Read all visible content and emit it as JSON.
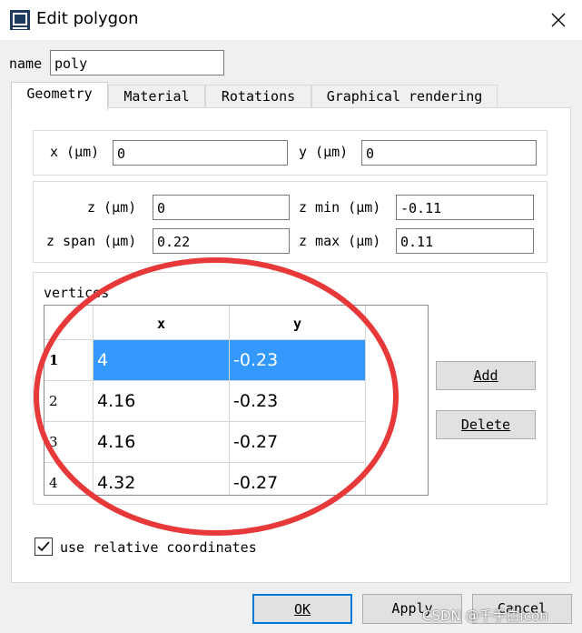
{
  "window": {
    "title": "Edit polygon",
    "icon": "app-window-icon",
    "close_icon": "close-icon"
  },
  "name_row": {
    "label": "name",
    "value": "poly"
  },
  "tabs": [
    {
      "label": "Geometry",
      "active": true
    },
    {
      "label": "Material",
      "active": false
    },
    {
      "label": "Rotations",
      "active": false
    },
    {
      "label": "Graphical rendering",
      "active": false
    }
  ],
  "geometry": {
    "x": {
      "label": "x (μm)",
      "value": "0"
    },
    "y": {
      "label": "y (μm)",
      "value": "0"
    },
    "z": {
      "label": "z (μm)",
      "value": "0"
    },
    "z_min": {
      "label": "z min (μm)",
      "value": "-0.11"
    },
    "z_span": {
      "label": "z span (μm)",
      "value": "0.22"
    },
    "z_max": {
      "label": "z max (μm)",
      "value": "0.11"
    }
  },
  "vertices": {
    "label": "vertices",
    "columns": [
      "x",
      "y"
    ],
    "rows": [
      {
        "index": "1",
        "x": "4",
        "y": "-0.23",
        "selected": true
      },
      {
        "index": "2",
        "x": "4.16",
        "y": "-0.23",
        "selected": false
      },
      {
        "index": "3",
        "x": "4.16",
        "y": "-0.27",
        "selected": false
      },
      {
        "index": "4",
        "x": "4.32",
        "y": "-0.27",
        "selected": false
      }
    ],
    "add_button": "Add",
    "delete_button": "Delete"
  },
  "relative_coords": {
    "label": "use relative coordinates",
    "checked": true
  },
  "footer": {
    "ok": "OK",
    "apply": "Apply",
    "cancel": "Cancel"
  },
  "watermark": "CSDN @千手白icon",
  "colors": {
    "selection": "#3399ff",
    "annotation": "#e8393a",
    "primary_border": "#0078d7"
  }
}
